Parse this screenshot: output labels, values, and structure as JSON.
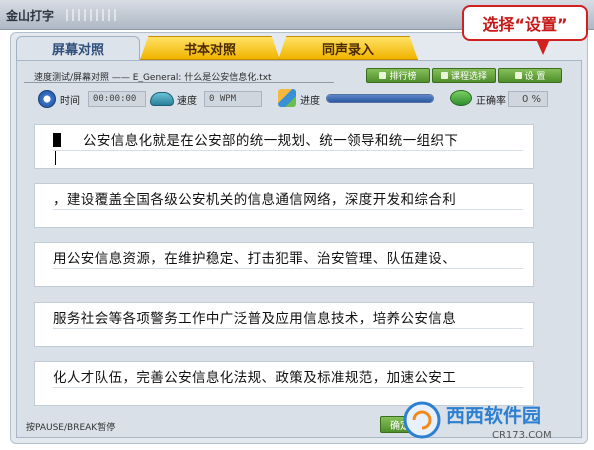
{
  "app": {
    "title": "金山打字"
  },
  "tabs": [
    {
      "label": "屏幕对照",
      "active": true
    },
    {
      "label": "书本对照",
      "active": false
    },
    {
      "label": "同声录入",
      "active": false
    }
  ],
  "callout": {
    "text": "选择“设置”"
  },
  "file": {
    "label": "速度测试/屏幕对照 —— E_General: 什么是公安信息化.txt"
  },
  "buttons": {
    "rank": "排行榜",
    "course": "课程选择",
    "settings": "设  置",
    "ok": "确定"
  },
  "stats": {
    "time_label": "时间",
    "time_value": "00:00:00",
    "speed_label": "速度",
    "speed_value": "0 WPM",
    "progress_label": "进度",
    "progress_value": 1.0,
    "accuracy_label": "正确率",
    "accuracy_value": "0 %"
  },
  "lines": [
    "公安信息化就是在公安部的统一规划、统一领导和统一组织下",
    "，建设覆盖全国各级公安机关的信息通信网络，深度开发和综合利",
    "用公安信息资源，在维护稳定、打击犯罪、治安管理、队伍建设、",
    "服务社会等各项警务工作中广泛普及应用信息技术，培养公安信息",
    "化人才队伍，完善公安信息化法规、政策及标准规范，加速公安工"
  ],
  "status": {
    "hint": "按PAUSE/BREAK暂停"
  },
  "watermark": {
    "brand": "西西软件园",
    "domain": "CR173.COM"
  },
  "colors": {
    "accent_red": "#c81818",
    "tab_yellow": "#f0b400",
    "button_green": "#4f8e2a",
    "progress_blue": "#2c57a2"
  }
}
